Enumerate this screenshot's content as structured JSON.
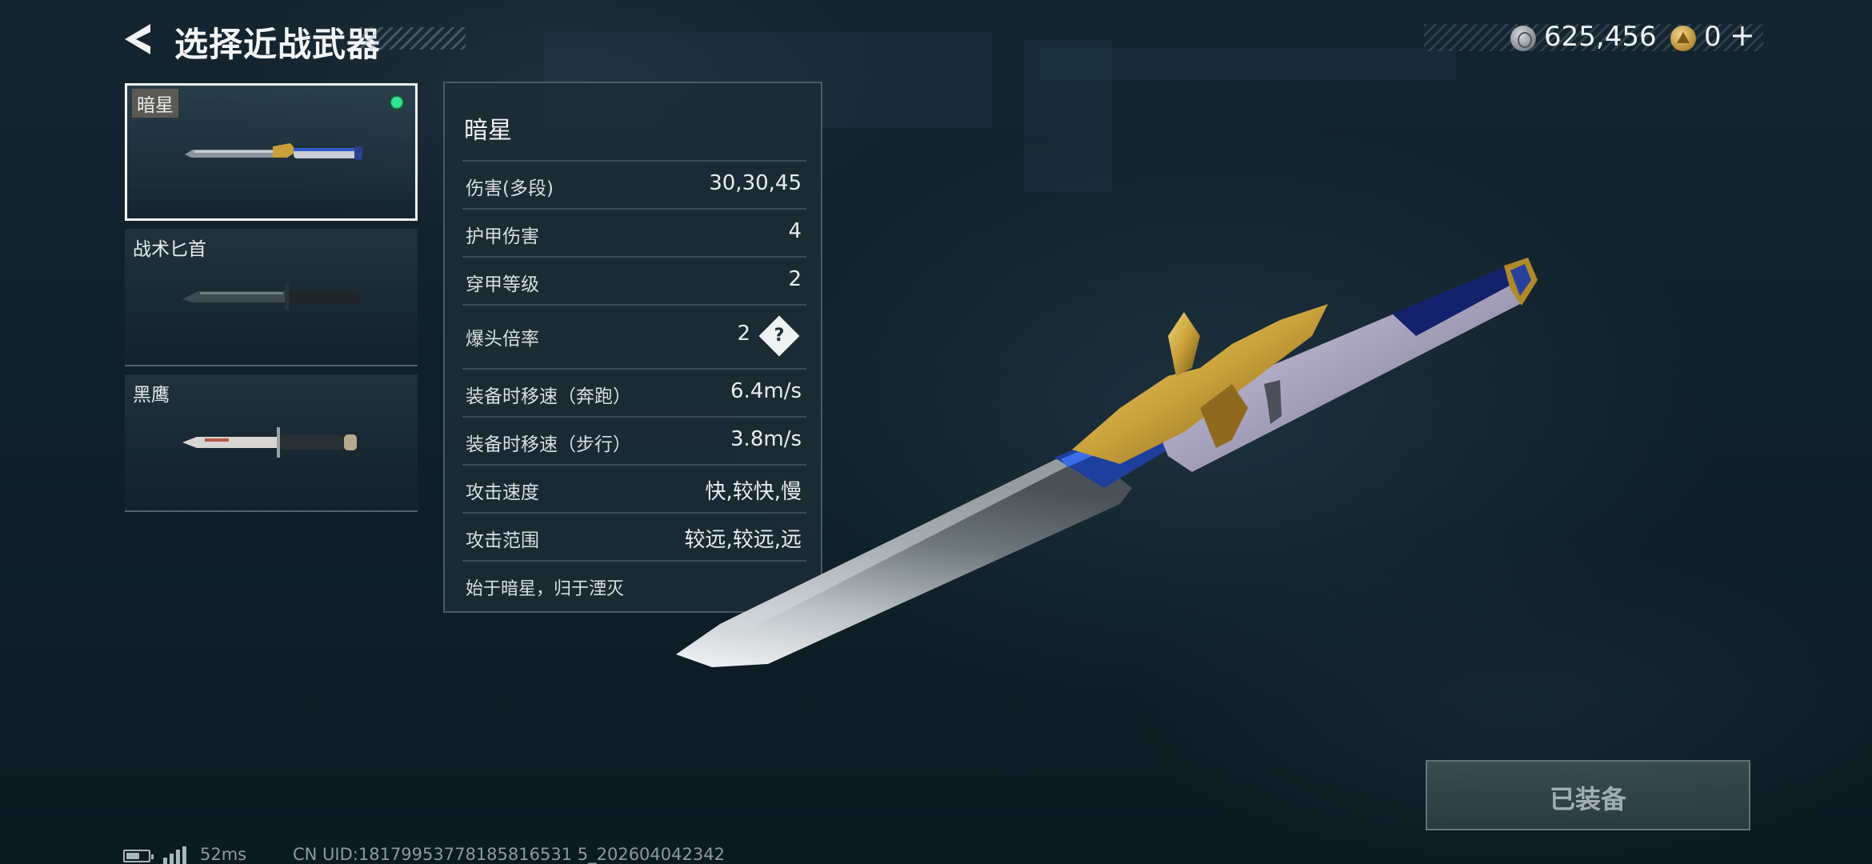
{
  "header": {
    "title": "选择近战武器",
    "currency_silver": "625,456",
    "currency_gold": "0",
    "add_label": "+"
  },
  "weapons": [
    {
      "name": "暗星",
      "equipped": true,
      "selected": true
    },
    {
      "name": "战术匕首",
      "equipped": false,
      "selected": false
    },
    {
      "name": "黑鹰",
      "equipped": false,
      "selected": false
    }
  ],
  "details": {
    "name": "暗星",
    "stats": [
      {
        "label": "伤害(多段)",
        "value": "30,30,45"
      },
      {
        "label": "护甲伤害",
        "value": "4"
      },
      {
        "label": "穿甲等级",
        "value": "2"
      },
      {
        "label": "爆头倍率",
        "value": "2",
        "help": "?"
      },
      {
        "label": "装备时移速（奔跑）",
        "value": "6.4m/s"
      },
      {
        "label": "装备时移速（步行）",
        "value": "3.8m/s"
      },
      {
        "label": "攻击速度",
        "value": "快,较快,慢"
      },
      {
        "label": "攻击范围",
        "value": "较远,较远,远"
      }
    ],
    "description": "始于暗星，归于湮灭"
  },
  "equip_button": {
    "label": "已装备",
    "state": "equipped"
  },
  "footer": {
    "ping": "52ms",
    "uid": "CN UID:18179953778185816531 5_202604042342"
  },
  "colors": {
    "equipped_indicator": "#2fe68c",
    "panel_bg": "#1c2c36",
    "accent_gold": "#c9a13a"
  },
  "icons": {
    "back": "back-arrow-icon",
    "silver_coin": "silver-coin-icon",
    "gold_coin": "gold-coin-icon",
    "help": "help-icon",
    "battery": "battery-icon",
    "signal": "signal-icon"
  }
}
